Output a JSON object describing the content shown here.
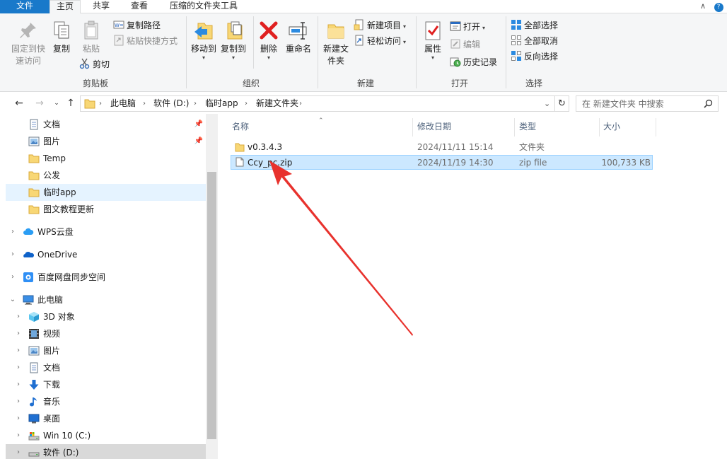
{
  "ribbon_tabs": [
    {
      "label": "文件"
    },
    {
      "label": "主页"
    },
    {
      "label": "共享"
    },
    {
      "label": "查看"
    },
    {
      "label": "压缩的文件夹工具"
    }
  ],
  "window_controls": {
    "collapse": "∧",
    "help": "?"
  },
  "clipboard": {
    "pin_label": "固定到快速访问",
    "copy_label": "复制",
    "paste_label": "粘贴",
    "copy_path_label": "复制路径",
    "paste_shortcut_label": "粘贴快捷方式",
    "cut_label": "剪切",
    "group_label": "剪贴板"
  },
  "organize": {
    "move_to_label": "移动到",
    "copy_to_label": "复制到",
    "delete_label": "删除",
    "rename_label": "重命名",
    "group_label": "组织"
  },
  "new": {
    "new_folder_label": "新建文件夹",
    "new_item_label": "新建项目",
    "easy_access_label": "轻松访问",
    "group_label": "新建"
  },
  "open": {
    "properties_label": "属性",
    "open_label": "打开",
    "edit_label": "编辑",
    "history_label": "历史记录",
    "group_label": "打开"
  },
  "select": {
    "select_all_label": "全部选择",
    "select_none_label": "全部取消",
    "invert_label": "反向选择",
    "group_label": "选择"
  },
  "address": {
    "breadcrumbs": [
      "此电脑",
      "软件 (D:)",
      "临时app",
      "新建文件夹"
    ],
    "search_placeholder": "在 新建文件夹 中搜索"
  },
  "nav_pane": {
    "quick_access": [
      {
        "label": "文档",
        "icon": "document-icon",
        "pinned": true
      },
      {
        "label": "图片",
        "icon": "picture-icon",
        "pinned": true
      },
      {
        "label": "Temp",
        "icon": "folder-icon"
      },
      {
        "label": "公发",
        "icon": "folder-icon"
      },
      {
        "label": "临时app",
        "icon": "folder-icon",
        "selected": true
      },
      {
        "label": "图文教程更新",
        "icon": "folder-icon"
      }
    ],
    "roots": [
      {
        "label": "WPS云盘",
        "icon": "cloud-icon"
      },
      {
        "label": "OneDrive",
        "icon": "onedrive-icon"
      },
      {
        "label": "百度网盘同步空间",
        "icon": "baidu-netdisk-icon"
      },
      {
        "label": "此电脑",
        "icon": "computer-icon",
        "expanded": true
      }
    ],
    "this_pc": [
      {
        "label": "3D 对象",
        "icon": "3d-objects-icon"
      },
      {
        "label": "视频",
        "icon": "video-icon"
      },
      {
        "label": "图片",
        "icon": "picture-icon"
      },
      {
        "label": "文档",
        "icon": "document-icon"
      },
      {
        "label": "下载",
        "icon": "download-icon"
      },
      {
        "label": "音乐",
        "icon": "music-icon"
      },
      {
        "label": "桌面",
        "icon": "desktop-icon"
      },
      {
        "label": "Win 10 (C:)",
        "icon": "drive-c-icon"
      },
      {
        "label": "软件 (D:)",
        "icon": "drive-icon",
        "selected": true
      }
    ]
  },
  "columns": [
    "名称",
    "修改日期",
    "类型",
    "大小"
  ],
  "files": [
    {
      "name": "v0.3.4.3",
      "modified": "2024/11/11 15:14",
      "type": "文件夹",
      "size": "",
      "icon": "folder-icon"
    },
    {
      "name": "Ccy_pc.zip",
      "modified": "2024/11/19 14:30",
      "type": "zip file",
      "size": "100,733 KB",
      "icon": "zip-file-icon",
      "selected": true
    }
  ],
  "colors": {
    "accent": "#1979ca",
    "selection": "#cce8ff",
    "annotation_arrow": "#e8322d"
  }
}
